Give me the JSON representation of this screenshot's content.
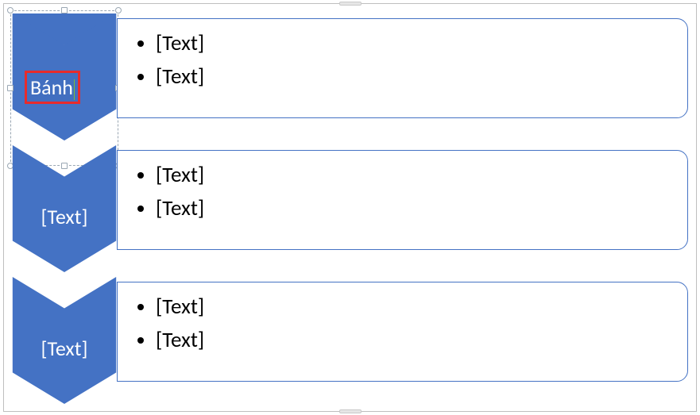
{
  "colors": {
    "accent": "#4472C4",
    "highlight": "#e82b2b"
  },
  "rows": [
    {
      "chevron_label": "Bánh",
      "selected": true,
      "bullets": [
        "[Text]",
        "[Text]"
      ]
    },
    {
      "chevron_label": "[Text]",
      "selected": false,
      "bullets": [
        "[Text]",
        "[Text]"
      ]
    },
    {
      "chevron_label": "[Text]",
      "selected": false,
      "bullets": [
        "[Text]",
        "[Text]"
      ]
    }
  ]
}
